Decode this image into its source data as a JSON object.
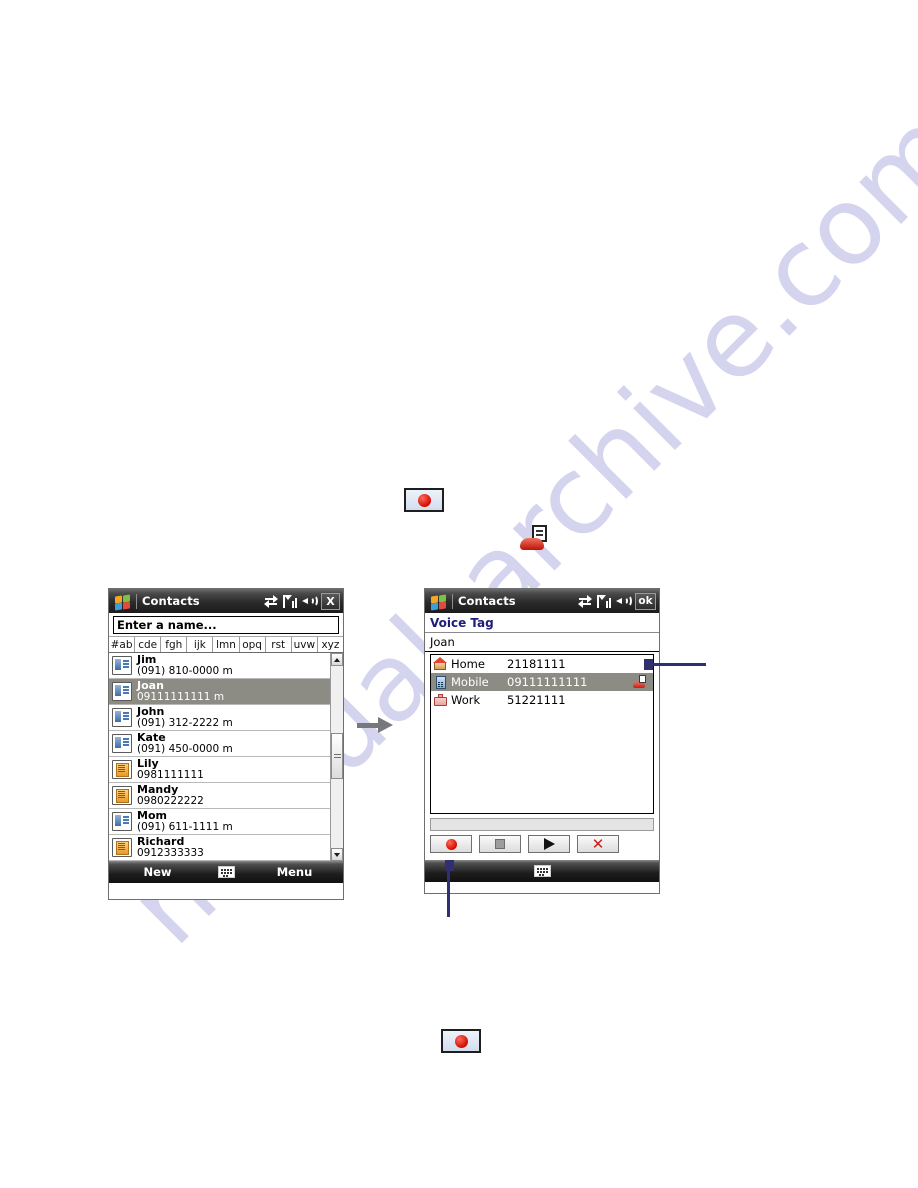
{
  "watermark": {
    "text": "manualsarchive.com"
  },
  "left_screen": {
    "titlebar": {
      "app_title": "Contacts",
      "icons": [
        "connectivity-icon",
        "signal-icon",
        "speaker-icon"
      ],
      "close_label": "X"
    },
    "search": {
      "value": "Enter a name...",
      "placeholder": "Enter a name..."
    },
    "alpha_tabs": [
      "#ab",
      "cde",
      "fgh",
      "ijk",
      "lmn",
      "opq",
      "rst",
      "uvw",
      "xyz"
    ],
    "contacts": [
      {
        "name": "Jim",
        "number": "(091) 810-0000   m",
        "icon": "contact-card-icon",
        "selected": false
      },
      {
        "name": "Joan",
        "number": "09111111111   m",
        "icon": "contact-card-icon",
        "selected": true
      },
      {
        "name": "John",
        "number": "(091) 312-2222   m",
        "icon": "contact-card-icon",
        "selected": false
      },
      {
        "name": "Kate",
        "number": "(091) 450-0000   m",
        "icon": "contact-card-icon",
        "selected": false
      },
      {
        "name": "Lily",
        "number": "0981111111",
        "icon": "sim-card-icon",
        "selected": false
      },
      {
        "name": "Mandy",
        "number": "0980222222",
        "icon": "sim-card-icon",
        "selected": false
      },
      {
        "name": "Mom",
        "number": "(091) 611-1111   m",
        "icon": "contact-card-icon",
        "selected": false
      },
      {
        "name": "Richard",
        "number": "0912333333",
        "icon": "sim-card-icon",
        "selected": false
      }
    ],
    "softkeys": {
      "left_label": "New",
      "center_icon": "keyboard-icon",
      "right_label": "Menu"
    }
  },
  "right_screen": {
    "titlebar": {
      "app_title": "Contacts",
      "icons": [
        "connectivity-icon",
        "signal-icon",
        "speaker-icon"
      ],
      "ok_label": "ok"
    },
    "page_title": "Voice Tag",
    "contact_name": "Joan",
    "number_rows": [
      {
        "label": "Home",
        "number": "21181111",
        "icon": "home-icon",
        "selected": false,
        "has_voice_tag": false
      },
      {
        "label": "Mobile",
        "number": "09111111111",
        "icon": "mobile-icon",
        "selected": true,
        "has_voice_tag": true
      },
      {
        "label": "Work",
        "number": "51221111",
        "icon": "work-icon",
        "selected": false,
        "has_voice_tag": false
      }
    ],
    "controls": [
      {
        "name": "record",
        "icon": "record-icon"
      },
      {
        "name": "stop",
        "icon": "stop-icon"
      },
      {
        "name": "play",
        "icon": "play-icon"
      },
      {
        "name": "delete",
        "icon": "delete-icon",
        "glyph": "✕"
      }
    ],
    "softkeys": {
      "center_icon": "keyboard-icon"
    }
  },
  "annotations": {
    "record_button_top": {
      "icon": "record-icon"
    },
    "voice_tag_icon": {
      "icon": "voice-tag-icon"
    },
    "record_button_bottom": {
      "icon": "record-icon"
    },
    "flow_arrow": {
      "icon": "arrow-right-icon"
    }
  },
  "colors": {
    "accent_navy": "#1d1d7a",
    "callout": "#2f2f72",
    "selection": "#8c8c84",
    "record_red": "#d10b00",
    "watermark": "#d5d4ee"
  }
}
